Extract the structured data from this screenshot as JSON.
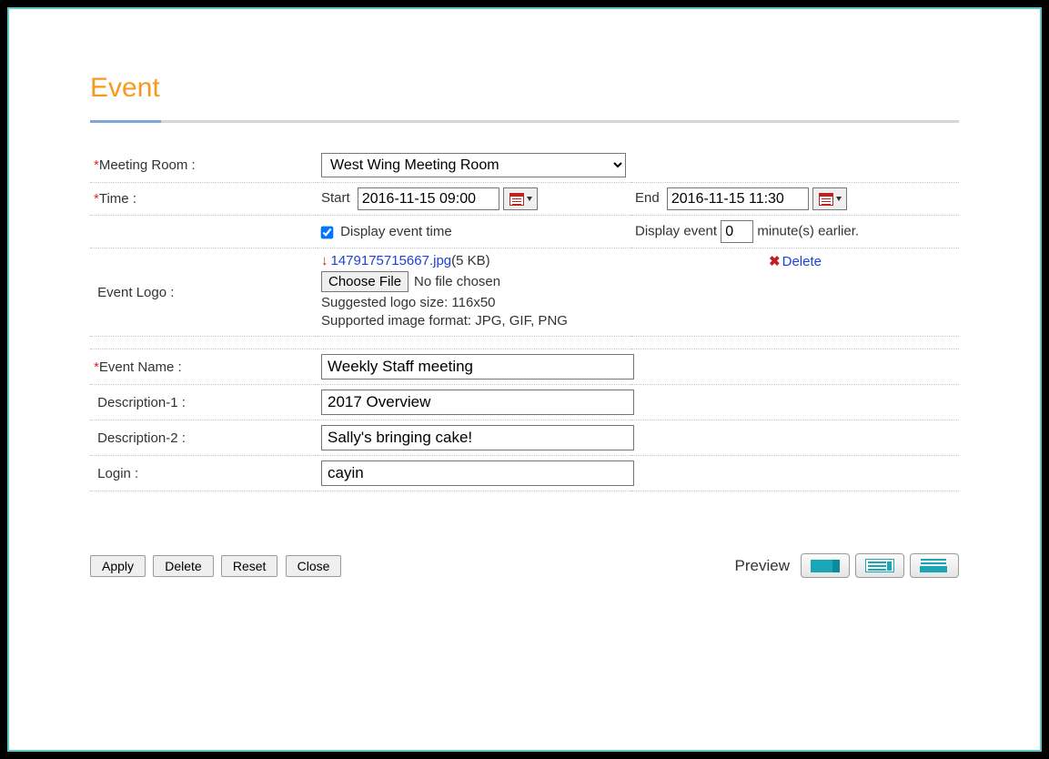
{
  "title": "Event",
  "labels": {
    "meeting_room": "Meeting Room :",
    "time": "Time :",
    "start": "Start",
    "end": "End",
    "display_event_time": "Display event time",
    "display_event": "Display event",
    "minutes_earlier": "minute(s) earlier.",
    "event_logo": "Event Logo :",
    "choose_file": "Choose File",
    "no_file": "No file chosen",
    "delete": "Delete",
    "event_name": "Event Name :",
    "description1": "Description-1 :",
    "description2": "Description-2 :",
    "login": "Login :",
    "preview": "Preview"
  },
  "fields": {
    "meeting_room": "West Wing Meeting Room",
    "start": "2016-11-15 09:00",
    "end": "2016-11-15 11:30",
    "display_event_time_checked": true,
    "display_earlier_minutes": "0",
    "logo_filename": "1479175715667.jpg",
    "logo_size": "(5 KB)",
    "suggested_size": "Suggested logo size: 116x50",
    "supported_format": "Supported image format: JPG, GIF, PNG",
    "event_name": "Weekly Staff meeting",
    "description1": "2017 Overview",
    "description2": "Sally's bringing cake!",
    "login": "cayin"
  },
  "buttons": {
    "apply": "Apply",
    "delete": "Delete",
    "reset": "Reset",
    "close": "Close"
  }
}
